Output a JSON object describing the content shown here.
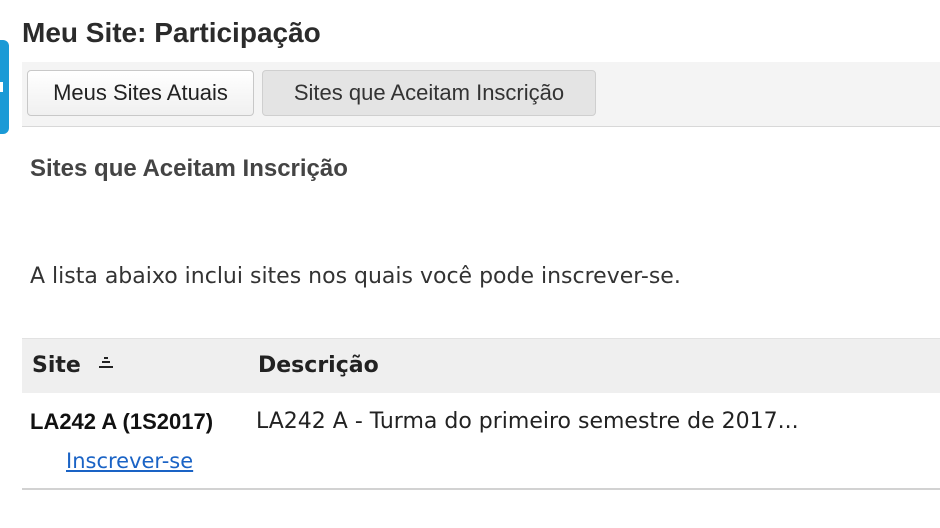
{
  "page": {
    "title": "Meu Site: Participação"
  },
  "toolbar": {
    "buttons": [
      {
        "label": "Meus Sites Atuais",
        "active": false
      },
      {
        "label": "Sites que Aceitam Inscrição",
        "active": true
      }
    ]
  },
  "section": {
    "title": "Sites que Aceitam Inscrição",
    "instructions": "A lista abaixo inclui sites nos quais você pode inscrever-se."
  },
  "table": {
    "columns": [
      {
        "label": "Site",
        "sort_icon": "sort-ascending-icon"
      },
      {
        "label": "Descrição"
      }
    ],
    "rows": [
      {
        "site": "LA242 A (1S2017)",
        "action": "Inscrever-se",
        "description": "LA242 A - Turma do primeiro semestre de 2017..."
      }
    ]
  },
  "colors": {
    "accent": "#1b9ad6",
    "link": "#1a63c5",
    "header_bg": "#efefef"
  }
}
